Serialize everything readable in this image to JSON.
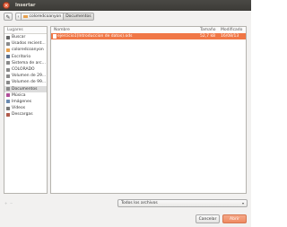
{
  "window": {
    "title": "Insertar"
  },
  "toolbar": {
    "path": [
      {
        "label": "coloredcoanyon",
        "active": false
      },
      {
        "label": "Documentos",
        "active": true
      }
    ]
  },
  "sidebar": {
    "header": "Lugares",
    "items": [
      {
        "label": "Buscar",
        "icon": "search-icon",
        "color": "#666666"
      },
      {
        "label": "Usados recient...",
        "icon": "clock-icon",
        "color": "#8a8a8a"
      },
      {
        "label": "coloredcoanyon",
        "icon": "home-folder-icon",
        "color": "#e8a04c"
      },
      {
        "label": "Escritorio",
        "icon": "desktop-folder-icon",
        "color": "#5b6f8c"
      },
      {
        "label": "Sistema de arc...",
        "icon": "drive-icon",
        "color": "#8a8a8a"
      },
      {
        "label": "COLORADO",
        "icon": "drive-icon",
        "color": "#8a8a8a"
      },
      {
        "label": "Volumen de 29...",
        "icon": "drive-icon",
        "color": "#8a8a8a"
      },
      {
        "label": "Volumen de 99...",
        "icon": "drive-icon",
        "color": "#8a8a8a"
      },
      {
        "label": "Documentos",
        "icon": "folder-icon",
        "color": "#8a8a8a",
        "selected": true
      },
      {
        "label": "Música",
        "icon": "music-icon",
        "color": "#b04e9a"
      },
      {
        "label": "Imágenes",
        "icon": "pictures-icon",
        "color": "#6a8ab0"
      },
      {
        "label": "Vídeos",
        "icon": "video-icon",
        "color": "#7a7a7a"
      },
      {
        "label": "Descargas",
        "icon": "downloads-icon",
        "color": "#b05a4a"
      }
    ]
  },
  "files": {
    "columns": {
      "name": "Nombre",
      "size": "Tamaño",
      "modified": "Modificado"
    },
    "rows": [
      {
        "name": "ejercicio1(Introduccion de datos).ods",
        "size": "52,7 kB",
        "modified": "16/08/13"
      }
    ]
  },
  "filter": {
    "selected": "Todos los archivos"
  },
  "buttons": {
    "cancel": "Cancelar",
    "open": "Abrir"
  },
  "colors": {
    "accent": "#f07746",
    "open_button": "#ef8a62"
  }
}
